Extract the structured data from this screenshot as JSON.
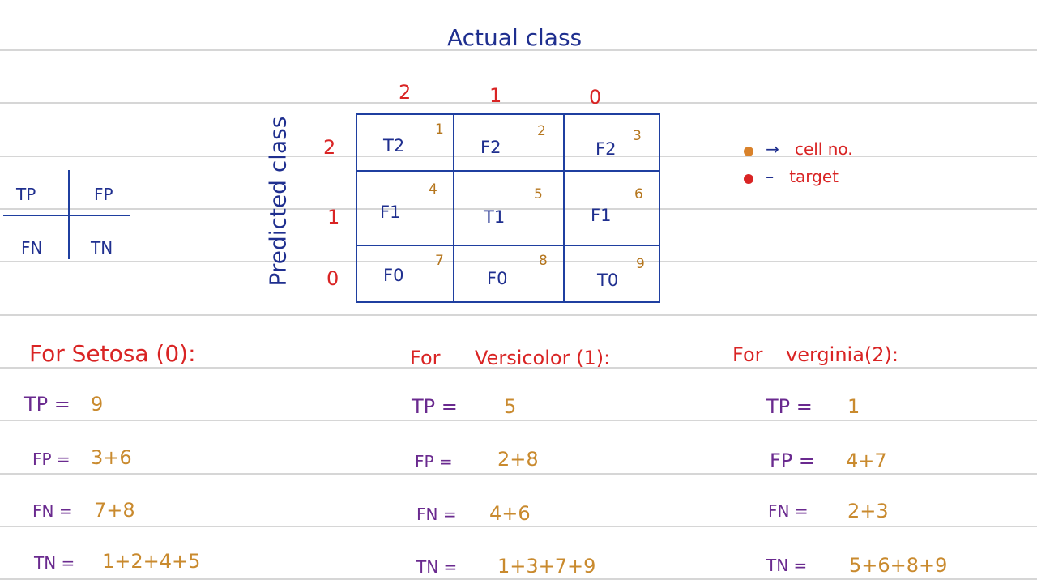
{
  "actual_class_label": "Actual class",
  "predicted_class_label": "Predicted class",
  "actual_headers": [
    "2",
    "1",
    "0"
  ],
  "predicted_headers": [
    "2",
    "1",
    "0"
  ],
  "cells": [
    {
      "label": "T2",
      "number": "1"
    },
    {
      "label": "F2",
      "number": "2"
    },
    {
      "label": "F2",
      "number": "3"
    },
    {
      "label": "F1",
      "number": "4"
    },
    {
      "label": "T1",
      "number": "5"
    },
    {
      "label": "F1",
      "number": "6"
    },
    {
      "label": "F0",
      "number": "7"
    },
    {
      "label": "F0",
      "number": "8"
    },
    {
      "label": "T0",
      "number": "9"
    }
  ],
  "legend": [
    {
      "text": "cell no.",
      "color": "#c98a2e"
    },
    {
      "text": "target",
      "color": "#d92424"
    }
  ],
  "mini_matrix": {
    "tp": "TP",
    "fp": "FP",
    "fn": "FN",
    "tn": "TN"
  },
  "sections": [
    {
      "title": "For Setosa (0):",
      "tp_label": "TP =",
      "tp": "9",
      "fp_label": "FP =",
      "fp": "3+6",
      "fn_label": "FN =",
      "fn": "7+8",
      "tn_label": "TN =",
      "tn": "1+2+4+5"
    },
    {
      "title_prefix": "For",
      "title": "Versicolor (1):",
      "tp_label": "TP =",
      "tp": "5",
      "fp_label": "FP =",
      "fp": "2+8",
      "fn_label": "FN =",
      "fn": "4+6",
      "tn_label": "TN =",
      "tn": "1+3+7+9"
    },
    {
      "title_prefix": "For",
      "title": "verginia(2):",
      "tp_label": "TP =",
      "tp": "1",
      "fp_label": "FP =",
      "fp": "4+7",
      "fn_label": "FN =",
      "fn": "2+3",
      "tn_label": "TN =",
      "tn": "5+6+8+9"
    }
  ],
  "colors": {
    "ink_blue": "#1f2f8f",
    "red": "#d92424",
    "orange": "#c98a2e",
    "purple": "#6a2a8f",
    "grid_blue": "#1f3fa0"
  }
}
